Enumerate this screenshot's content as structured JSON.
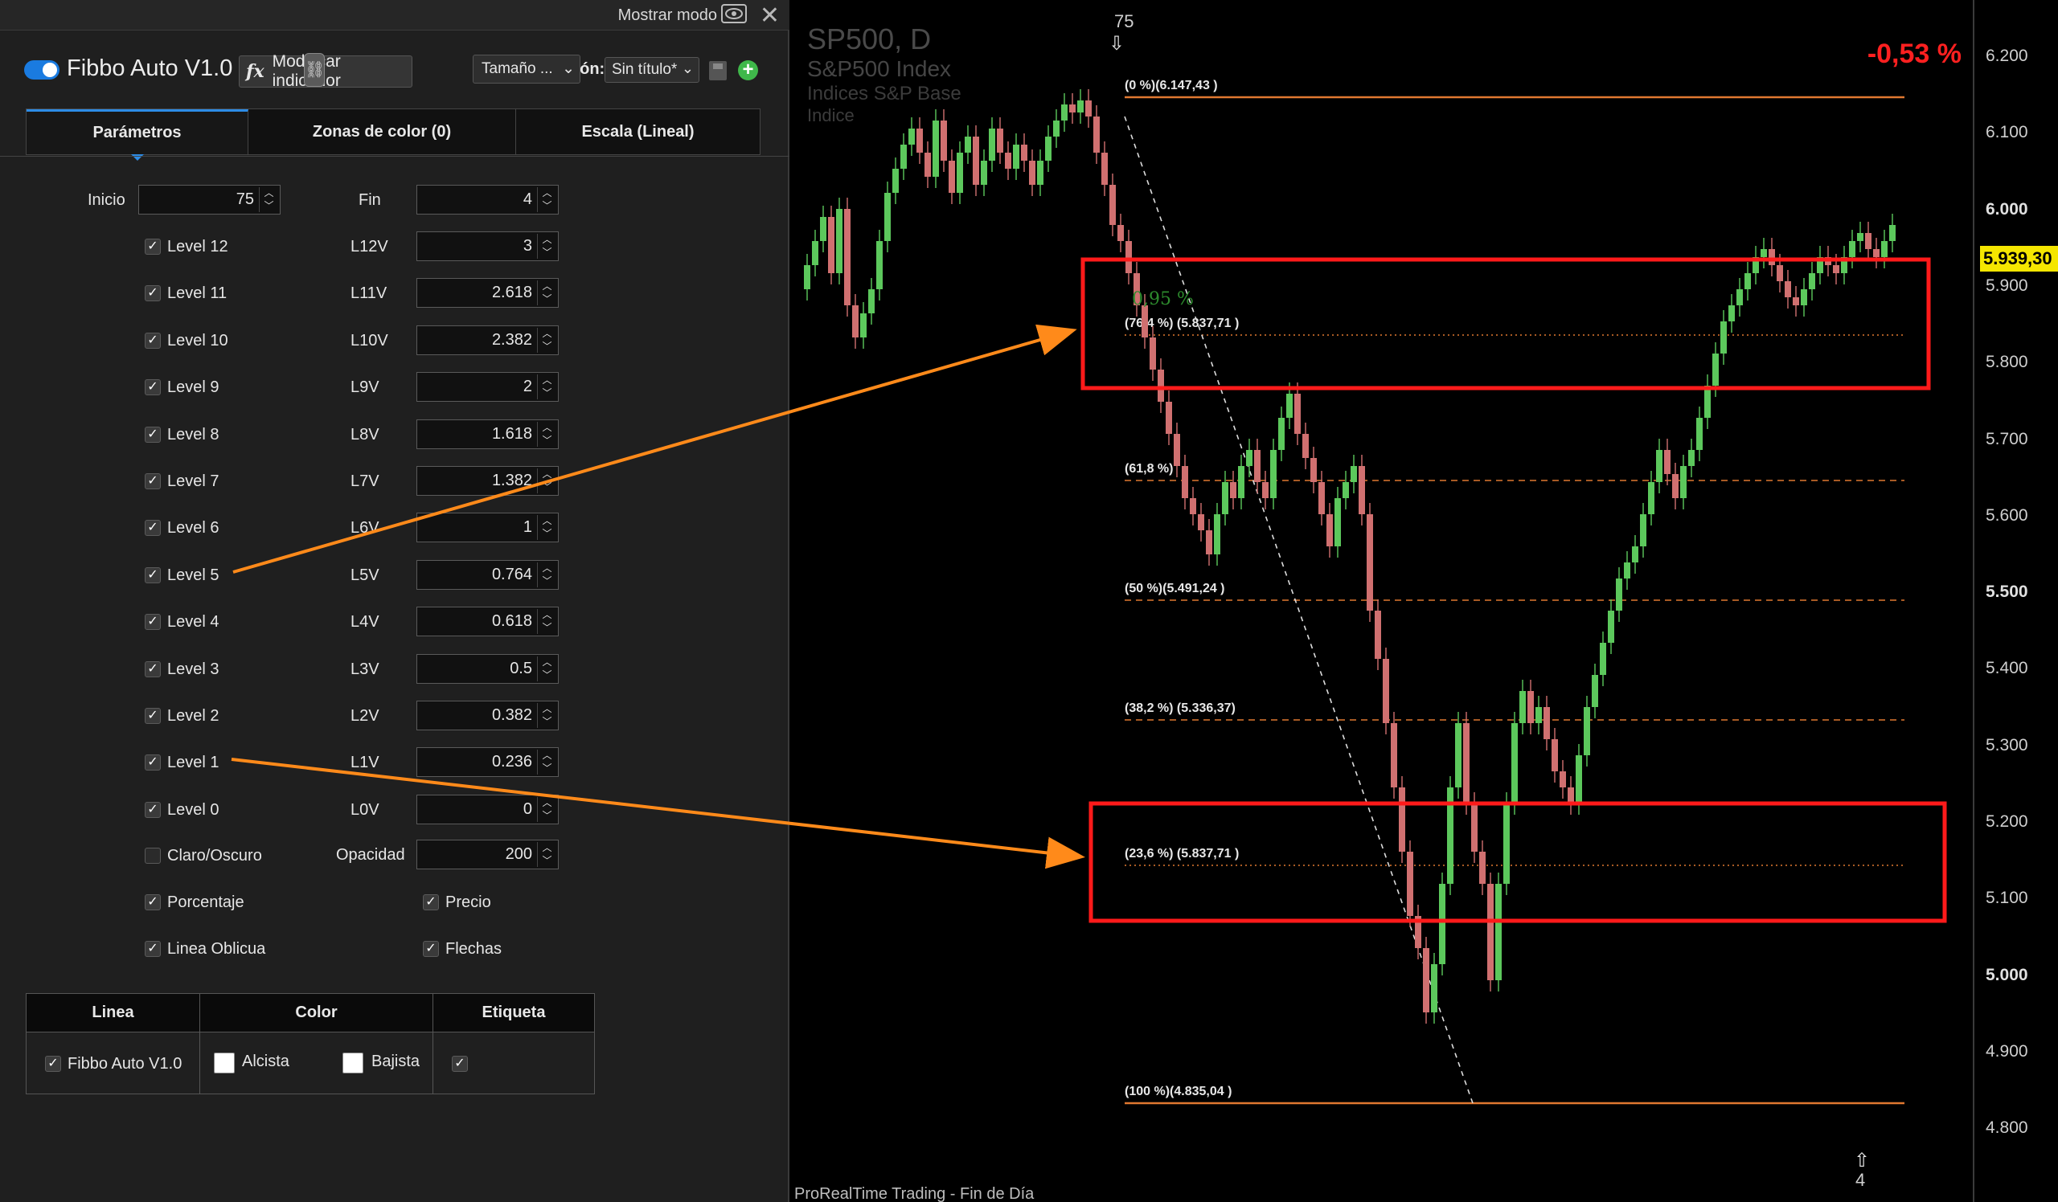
{
  "panel": {
    "header_mode_label": "Mostrar modo",
    "indicator_title": "Fibbo Auto V1.0",
    "modify_button_label": "Modificar indicador",
    "fx_symbol": "fx",
    "config_label": "Configuración:",
    "config_value": "Sin título*",
    "tabs": [
      {
        "label": "Parámetros",
        "active": true
      },
      {
        "label": "Zonas de color (0)",
        "active": false
      },
      {
        "label": "Escala (Lineal)",
        "active": false
      }
    ],
    "inicio_label": "Inicio",
    "inicio_value": "75",
    "fin_label": "Fin",
    "fin_value": "4",
    "levels": [
      {
        "label": "Level 12",
        "checked": true,
        "value_label": "L12V",
        "value": "3"
      },
      {
        "label": "Level 11",
        "checked": true,
        "value_label": "L11V",
        "value": "2.618"
      },
      {
        "label": "Level 10",
        "checked": true,
        "value_label": "L10V",
        "value": "2.382"
      },
      {
        "label": "Level 9",
        "checked": true,
        "value_label": "L9V",
        "value": "2"
      },
      {
        "label": "Level 8",
        "checked": true,
        "value_label": "L8V",
        "value": "1.618"
      },
      {
        "label": "Level 7",
        "checked": true,
        "value_label": "L7V",
        "value": "1.382"
      },
      {
        "label": "Level 6",
        "checked": true,
        "value_label": "L6V",
        "value": "1"
      },
      {
        "label": "Level 5",
        "checked": true,
        "value_label": "L5V",
        "value": "0.764"
      },
      {
        "label": "Level 4",
        "checked": true,
        "value_label": "L4V",
        "value": "0.618"
      },
      {
        "label": "Level 3",
        "checked": true,
        "value_label": "L3V",
        "value": "0.5"
      },
      {
        "label": "Level 2",
        "checked": true,
        "value_label": "L2V",
        "value": "0.382"
      },
      {
        "label": "Level 1",
        "checked": true,
        "value_label": "L1V",
        "value": "0.236"
      },
      {
        "label": "Level 0",
        "checked": true,
        "value_label": "L0V",
        "value": "0"
      }
    ],
    "claro_label": "Claro/Oscuro",
    "claro_checked": false,
    "opacidad_label": "Opacidad",
    "opacidad_value": "200",
    "porcentaje_label": "Porcentaje",
    "precio_label": "Precio",
    "linea_oblicua_label": "Linea Oblicua",
    "flechas_label": "Flechas",
    "line_table": {
      "headers": [
        "Linea",
        "Color",
        "Etiqueta"
      ],
      "line_name": "Fibbo Auto V1.0",
      "alcista_label": "Alcista",
      "bajista_label": "Bajista",
      "size_label": "Tamaño ..."
    }
  },
  "chart": {
    "symbol_title": "SP500, D",
    "symbol_name": "S&P500 Index",
    "market": "Indices S&P Base",
    "type": "Indice",
    "change_pct": "-0,53 %",
    "side_pct": "0,95 %",
    "last_price": "5.939,30",
    "bar_start_label": "75",
    "bar_end_label": "4",
    "footer": "ProRealTime Trading - Fin de Día",
    "colors": {
      "up": "#5cc85c",
      "down": "#d07070",
      "fib_line": "#e07830",
      "highlight": "#ff1a1a",
      "arrow": "#ff8a1a"
    },
    "price_ticks": [
      {
        "label": "6.200",
        "bold": false
      },
      {
        "label": "6.100",
        "bold": false
      },
      {
        "label": "6.000",
        "bold": true
      },
      {
        "label": "5.900",
        "bold": false
      },
      {
        "label": "5.800",
        "bold": false
      },
      {
        "label": "5.700",
        "bold": false
      },
      {
        "label": "5.600",
        "bold": false
      },
      {
        "label": "5.500",
        "bold": true
      },
      {
        "label": "5.400",
        "bold": false
      },
      {
        "label": "5.300",
        "bold": false
      },
      {
        "label": "5.200",
        "bold": false
      },
      {
        "label": "5.100",
        "bold": false
      },
      {
        "label": "5.000",
        "bold": true
      },
      {
        "label": "4.900",
        "bold": false
      },
      {
        "label": "4.800",
        "bold": false
      }
    ],
    "fib_levels": [
      {
        "label": "(0 %)(6.147,43 )",
        "style": "solid"
      },
      {
        "label": "(76,4 %)  (5.837,71 )",
        "style": "dotted"
      },
      {
        "label": "(61,8 %)",
        "style": "dashed"
      },
      {
        "label": "(50 %)(5.491,24 )",
        "style": "dashed"
      },
      {
        "label": "(38,2 %)  (5.336,37)",
        "style": "dashed"
      },
      {
        "label": "(23,6 %)  (5.837,71 )",
        "style": "dotted"
      },
      {
        "label": "(100 %)(4.835,04 )",
        "style": "solid"
      }
    ]
  }
}
